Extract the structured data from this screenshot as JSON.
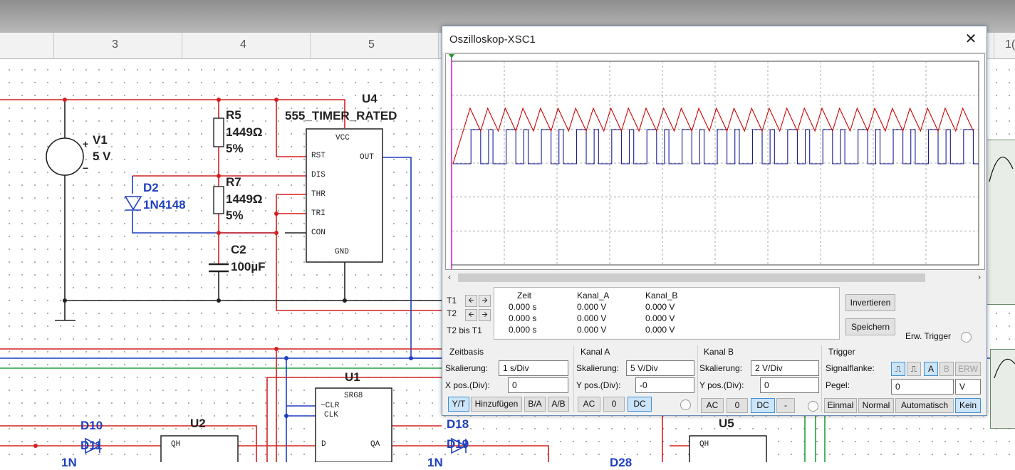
{
  "ruler": {
    "labels": [
      "3",
      "4",
      "5",
      "1("
    ]
  },
  "schematic": {
    "v1": {
      "name": "V1",
      "value": "5 V",
      "plus": "+",
      "minus": "−"
    },
    "r5": {
      "name": "R5",
      "value": "1449Ω",
      "tol": "5%"
    },
    "r7": {
      "name": "R7",
      "value": "1449Ω",
      "tol": "5%"
    },
    "c2": {
      "name": "C2",
      "value": "100µF"
    },
    "d2": {
      "name": "D2",
      "part": "1N4148"
    },
    "u4": {
      "name": "U4",
      "part": "555_TIMER_RATED",
      "pins": {
        "vcc": "VCC",
        "rst": "RST",
        "out": "OUT",
        "dis": "DIS",
        "thr": "THR",
        "tri": "TRI",
        "con": "CON",
        "gnd": "GND"
      }
    },
    "u1": {
      "name": "U1",
      "part": "SRG8",
      "pins": {
        "clr": "~CLR",
        "clk": "CLK",
        "d": "D",
        "qa": "QA"
      }
    },
    "u2": {
      "name": "U2",
      "pin": "QH"
    },
    "u5": {
      "name": "U5",
      "pin": "QH"
    },
    "d10": {
      "name": "D10"
    },
    "d18": {
      "name": "D18"
    },
    "d11": {
      "name": "D11"
    },
    "d19": {
      "name": "D19"
    },
    "partial": {
      "left": "1N",
      "right": "1N",
      "d28": "D28"
    }
  },
  "oscilloscope": {
    "title": "Oszilloskop-XSC1",
    "close_label": "✕",
    "cursor_labels": {
      "t1": "T1",
      "t2": "T2",
      "t2_t1": "T2 bis T1"
    },
    "readout": {
      "headers": [
        "Zeit",
        "Kanal_A",
        "Kanal_B"
      ],
      "rows": [
        [
          "0.000 s",
          "0.000 V",
          "0.000 V"
        ],
        [
          "0.000 s",
          "0.000 V",
          "0.000 V"
        ],
        [
          "0.000 s",
          "0.000 V",
          "0.000 V"
        ]
      ]
    },
    "buttons": {
      "invert": "Invertieren",
      "save": "Speichern",
      "ext_trigger": "Erw. Trigger"
    },
    "zeitbasis": {
      "header": "Zeitbasis",
      "scale_label": "Skalierung:",
      "scale_value": "1  s/Div",
      "xpos_label": "X pos.(Div):",
      "xpos_value": "0",
      "modes": [
        "Y/T",
        "Hinzufügen",
        "B/A",
        "A/B"
      ]
    },
    "kanal_a": {
      "header": "Kanal A",
      "scale_label": "Skalierung:",
      "scale_value": "5  V/Div",
      "ypos_label": "Y pos.(Div):",
      "ypos_value": "-0",
      "coupling": [
        "AC",
        "0",
        "DC"
      ]
    },
    "kanal_b": {
      "header": "Kanal B",
      "scale_label": "Skalierung:",
      "scale_value": "2  V/Div",
      "ypos_label": "Y pos.(Div):",
      "ypos_value": "0",
      "coupling": [
        "AC",
        "0",
        "DC",
        "-"
      ]
    },
    "trigger": {
      "header": "Trigger",
      "edge_label": "Signalflanke:",
      "edge_rise": "⎍",
      "edge_fall": "⎍",
      "sources": [
        "A",
        "B",
        "ERW"
      ],
      "level_label": "Pegel:",
      "level_value": "0",
      "level_unit": "V",
      "modes": [
        "Einmal",
        "Normal",
        "Automatisch",
        "Kein"
      ]
    },
    "colors": {
      "channel_a": "#cc0000",
      "channel_b": "#1a1a99",
      "cursor": "#cc00cc"
    }
  }
}
